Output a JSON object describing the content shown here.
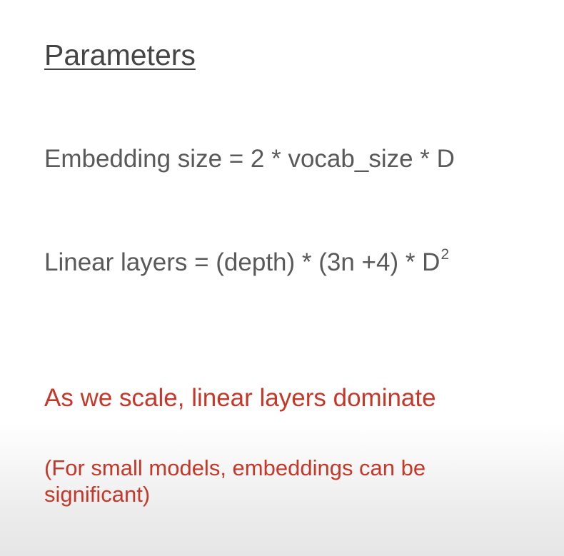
{
  "slide": {
    "title": "Parameters",
    "embedding_line": "Embedding size = 2 * vocab_size * D",
    "linear_line_main": "Linear layers = (depth) * (3n +4) * D",
    "linear_line_exponent": "2",
    "scale_line": "As we scale, linear layers dominate",
    "note_line": "(For small models, embeddings can be significant)"
  },
  "colors": {
    "title": "#444444",
    "body_text": "#595959",
    "accent_red": "#c53829",
    "background": "#ffffff"
  }
}
